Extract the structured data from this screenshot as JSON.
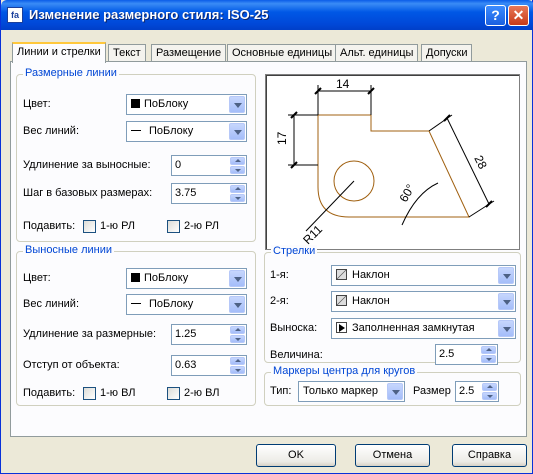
{
  "window": {
    "title": "Изменение размерного стиля: ISO-25",
    "help_button": "?",
    "close_button": "✕",
    "icon_glyph": "fa"
  },
  "tabs": [
    {
      "label": "Линии и стрелки",
      "active": true
    },
    {
      "label": "Текст"
    },
    {
      "label": "Размещение"
    },
    {
      "label": "Основные единицы"
    },
    {
      "label": "Альт. единицы"
    },
    {
      "label": "Допуски"
    }
  ],
  "dim_lines": {
    "title": "Размерные линии",
    "color_label": "Цвет:",
    "color_value": "ПоБлоку",
    "weight_label": "Вес линий:",
    "weight_value": "ПоБлоку",
    "extension_label": "Удлинение за выносные:",
    "extension_value": "0",
    "baseline_label": "Шаг в базовых размерах:",
    "baseline_value": "3.75",
    "suppress_label": "Подавить:",
    "suppress_1": "1-ю РЛ",
    "suppress_2": "2-ю РЛ"
  },
  "ext_lines": {
    "title": "Выносные линии",
    "color_label": "Цвет:",
    "color_value": "ПоБлоку",
    "weight_label": "Вес линий:",
    "weight_value": "ПоБлоку",
    "extension_label": "Удлинение за размерные:",
    "extension_value": "1.25",
    "offset_label": "Отступ от объекта:",
    "offset_value": "0.63",
    "suppress_label": "Подавить:",
    "suppress_1": "1-ю ВЛ",
    "suppress_2": "2-ю ВЛ"
  },
  "arrows": {
    "title": "Стрелки",
    "first_label": "1-я:",
    "first_value": "Наклон",
    "second_label": "2-я:",
    "second_value": "Наклон",
    "leader_label": "Выноска:",
    "leader_value": "Заполненная замкнутая",
    "size_label": "Величина:",
    "size_value": "2.5"
  },
  "center_marks": {
    "title": "Маркеры центра для кругов",
    "type_label": "Тип:",
    "type_value": "Только маркер",
    "size_label": "Размер",
    "size_value": "2.5"
  },
  "preview": {
    "dim_14": "14",
    "dim_17": "17",
    "dim_28": "28",
    "dim_60": "60°",
    "dim_r11": "R11"
  },
  "buttons": {
    "ok": "OK",
    "cancel": "Отмена",
    "help": "Справка"
  },
  "colors": {
    "titlebar": "#0054e3",
    "group_title": "#0046d5",
    "preview_shape": "#a06010"
  }
}
